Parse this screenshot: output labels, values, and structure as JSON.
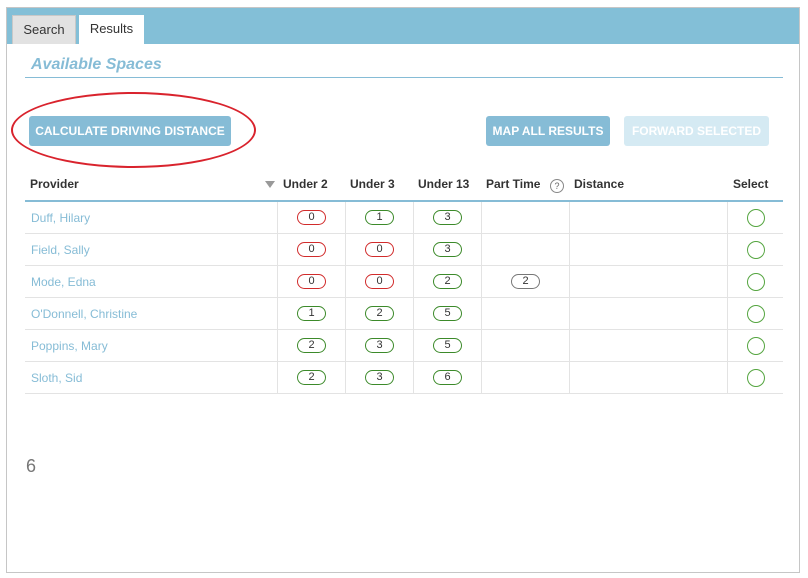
{
  "tabs": [
    {
      "label": "Search"
    },
    {
      "label": "Results"
    }
  ],
  "section_title": "Available Spaces",
  "buttons": {
    "calculate": "CALCULATE DRIVING DISTANCE",
    "map_all": "MAP ALL RESULTS",
    "forward": "FORWARD SELECTED"
  },
  "table": {
    "headers": {
      "provider": "Provider",
      "under2": "Under 2",
      "under3": "Under 3",
      "under13": "Under 13",
      "part_time": "Part Time",
      "distance": "Distance",
      "select": "Select"
    },
    "help_icon_glyph": "?",
    "rows": [
      {
        "provider": "Duff, Hilary",
        "under2": "0",
        "under3": "1",
        "under13": "3",
        "part_time": ""
      },
      {
        "provider": "Field, Sally",
        "under2": "0",
        "under3": "0",
        "under13": "3",
        "part_time": ""
      },
      {
        "provider": "Mode, Edna",
        "under2": "0",
        "under3": "0",
        "under13": "2",
        "part_time": "2"
      },
      {
        "provider": "O'Donnell, Christine",
        "under2": "1",
        "under3": "2",
        "under13": "5",
        "part_time": ""
      },
      {
        "provider": "Poppins, Mary",
        "under2": "2",
        "under3": "3",
        "under13": "5",
        "part_time": ""
      },
      {
        "provider": "Sloth, Sid",
        "under2": "2",
        "under3": "3",
        "under13": "6",
        "part_time": ""
      }
    ]
  },
  "result_count": "6",
  "colors": {
    "accent": "#86bcd6",
    "tab_bar": "#83bfd7",
    "zero_pill": "#d12b2b",
    "positive_pill": "#3c8a2a",
    "annotation": "#d9232d"
  }
}
